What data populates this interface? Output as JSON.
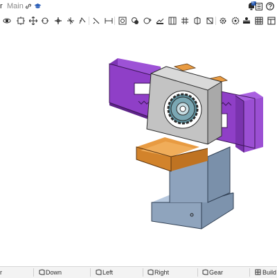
{
  "header": {
    "title": "r",
    "branch": "Main",
    "notification_count": "6"
  },
  "icons": {
    "link": "link-icon",
    "version": "graduation-cap-icon",
    "notifications": "bell-icon",
    "release": "list-icon",
    "help": "help-icon"
  },
  "toolbar": {
    "tools": [
      "view-cube-rotate-icon",
      "view-fit-icon",
      "move-icon",
      "orbit-icon",
      "pan-icon",
      "zoom-icon",
      "undo-arc-icon",
      "section-icon",
      "measure-icon",
      "sketch-icon",
      "mate-icon",
      "assembly-icon",
      "explode-icon",
      "gear-icon",
      "settings-icon",
      "grid-icon"
    ]
  },
  "tabs": [
    {
      "label": "r"
    },
    {
      "label": "Down"
    },
    {
      "label": "Left"
    },
    {
      "label": "Right"
    },
    {
      "label": "Gear"
    },
    {
      "label": "Build"
    }
  ],
  "colors": {
    "purple": "#8f3fc7",
    "orange": "#d98a2f",
    "gray_body": "#c3c3c3",
    "steel_blue": "#8fa4bd",
    "gear_teal": "#5d8f9c"
  }
}
